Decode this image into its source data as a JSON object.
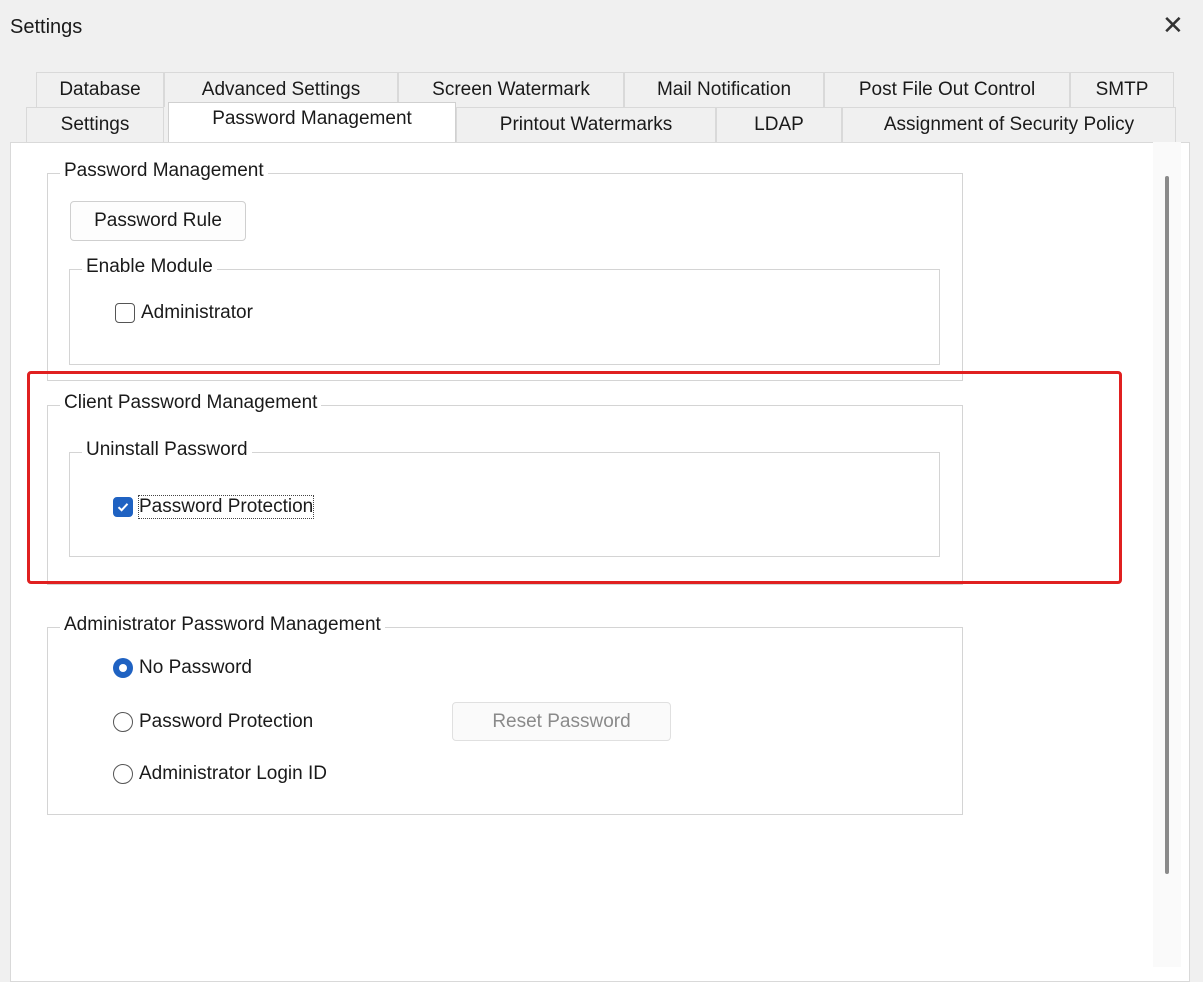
{
  "window": {
    "title": "Settings",
    "close_symbol": "✕"
  },
  "tabs_row1": [
    "Database",
    "Advanced Settings",
    "Screen Watermark",
    "Mail Notification",
    "Post File Out Control",
    "SMTP"
  ],
  "tabs_row2": [
    "Settings",
    "Password Management",
    "Printout Watermarks",
    "LDAP",
    "Assignment of Security Policy"
  ],
  "active_tab": "Password Management",
  "password_management": {
    "legend": "Password Management",
    "rule_button": "Password Rule",
    "enable_module": {
      "legend": "Enable Module",
      "administrator_label": "Administrator",
      "administrator_checked": false
    }
  },
  "client_password_management": {
    "legend": "Client Password Management",
    "uninstall": {
      "legend": "Uninstall Password",
      "protection_label": "Password Protection",
      "protection_checked": true
    }
  },
  "admin_password_management": {
    "legend": "Administrator Password Management",
    "options": [
      "No Password",
      "Password Protection",
      "Administrator Login ID"
    ],
    "selected": "No Password",
    "reset_button": "Reset Password"
  },
  "colors": {
    "accent": "#1f62c2",
    "highlight": "#e02020"
  }
}
